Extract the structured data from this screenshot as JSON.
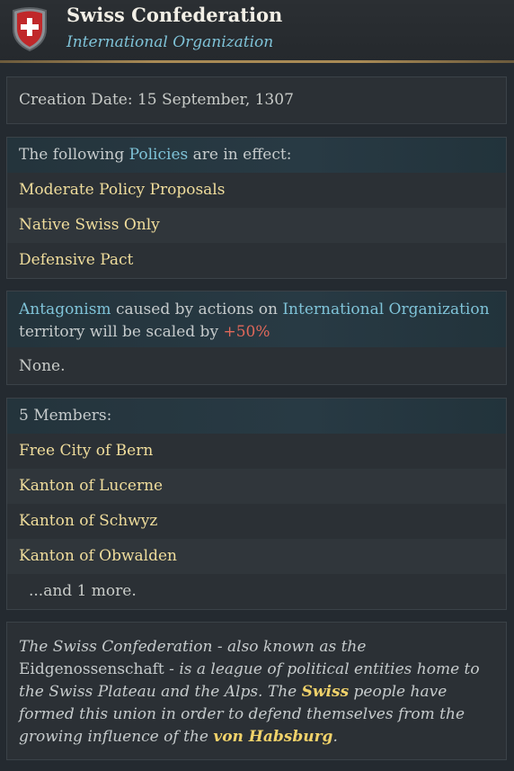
{
  "header": {
    "title": "Swiss Confederation",
    "subtitle": "International Organization",
    "emblem": "swiss-shield-icon"
  },
  "creation": {
    "text": "Creation Date: 15 September, 1307"
  },
  "policies": {
    "intro_prefix": "The following ",
    "intro_link": "Policies",
    "intro_suffix": " are in effect:",
    "items": [
      "Moderate Policy Proposals",
      "Native Swiss Only",
      "Defensive Pact"
    ]
  },
  "antagonism": {
    "link1": "Antagonism",
    "text1": " caused by actions on ",
    "link2": "International Organization",
    "text2": " territory will be scaled by ",
    "value": "+50%",
    "result": "None."
  },
  "members": {
    "count_label": "5 Members:",
    "items": [
      "Free City of Bern",
      "Kanton of Lucerne",
      "Kanton of Schwyz",
      "Kanton of Obwalden"
    ],
    "more": "...and 1 more."
  },
  "description": {
    "p1": "The Swiss Confederation - also known as the ",
    "native_name": "Eidgenossenschaft",
    "p2": " - is a league of political entities home to the Swiss Plateau and the Alps. The ",
    "people": "Swiss",
    "p3": " people have formed this union in order to defend themselves from the growing influence of the ",
    "rival": "von Habsburg",
    "p4": "."
  },
  "colors": {
    "accent_blue": "#7fc3d8",
    "gold_text": "#f0dd9c",
    "red_value": "#e0685a",
    "background": "#242a30"
  }
}
